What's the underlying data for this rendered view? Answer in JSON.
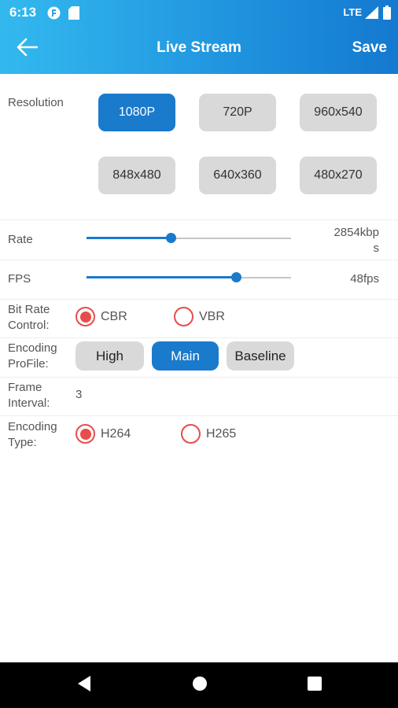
{
  "status_bar": {
    "time": "6:13",
    "network": "LTE"
  },
  "app_bar": {
    "title": "Live Stream",
    "save_label": "Save"
  },
  "resolution": {
    "label": "Resolution",
    "options": [
      "1080P",
      "720P",
      "960x540",
      "848x480",
      "640x360",
      "480x270"
    ],
    "selected": "1080P"
  },
  "rate": {
    "label": "Rate",
    "value_line1": "2854kbp",
    "value_line2": "s",
    "level": 0.41
  },
  "fps": {
    "label": "FPS",
    "value": "48fps",
    "level": 0.73
  },
  "bit_rate_control": {
    "label_line1": "Bit Rate",
    "label_line2": "Control:",
    "options": [
      "CBR",
      "VBR"
    ],
    "selected": "CBR"
  },
  "encoding_profile": {
    "label_line1": "Encoding",
    "label_line2": "ProFile:",
    "options": [
      "High",
      "Main",
      "Baseline"
    ],
    "selected": "Main"
  },
  "frame_interval": {
    "label_line1": "Frame",
    "label_line2": "Interval:",
    "value": "3"
  },
  "encoding_type": {
    "label_line1": "Encoding",
    "label_line2": "Type:",
    "options": [
      "H264",
      "H265"
    ],
    "selected": "H264"
  },
  "colors": {
    "accent": "#1a7acc",
    "radio": "#e84c4c",
    "header_start": "#33b9ee",
    "header_end": "#1479cf"
  },
  "icons": [
    "back-arrow-icon",
    "nav-back-icon",
    "nav-home-icon",
    "nav-recents-icon"
  ]
}
